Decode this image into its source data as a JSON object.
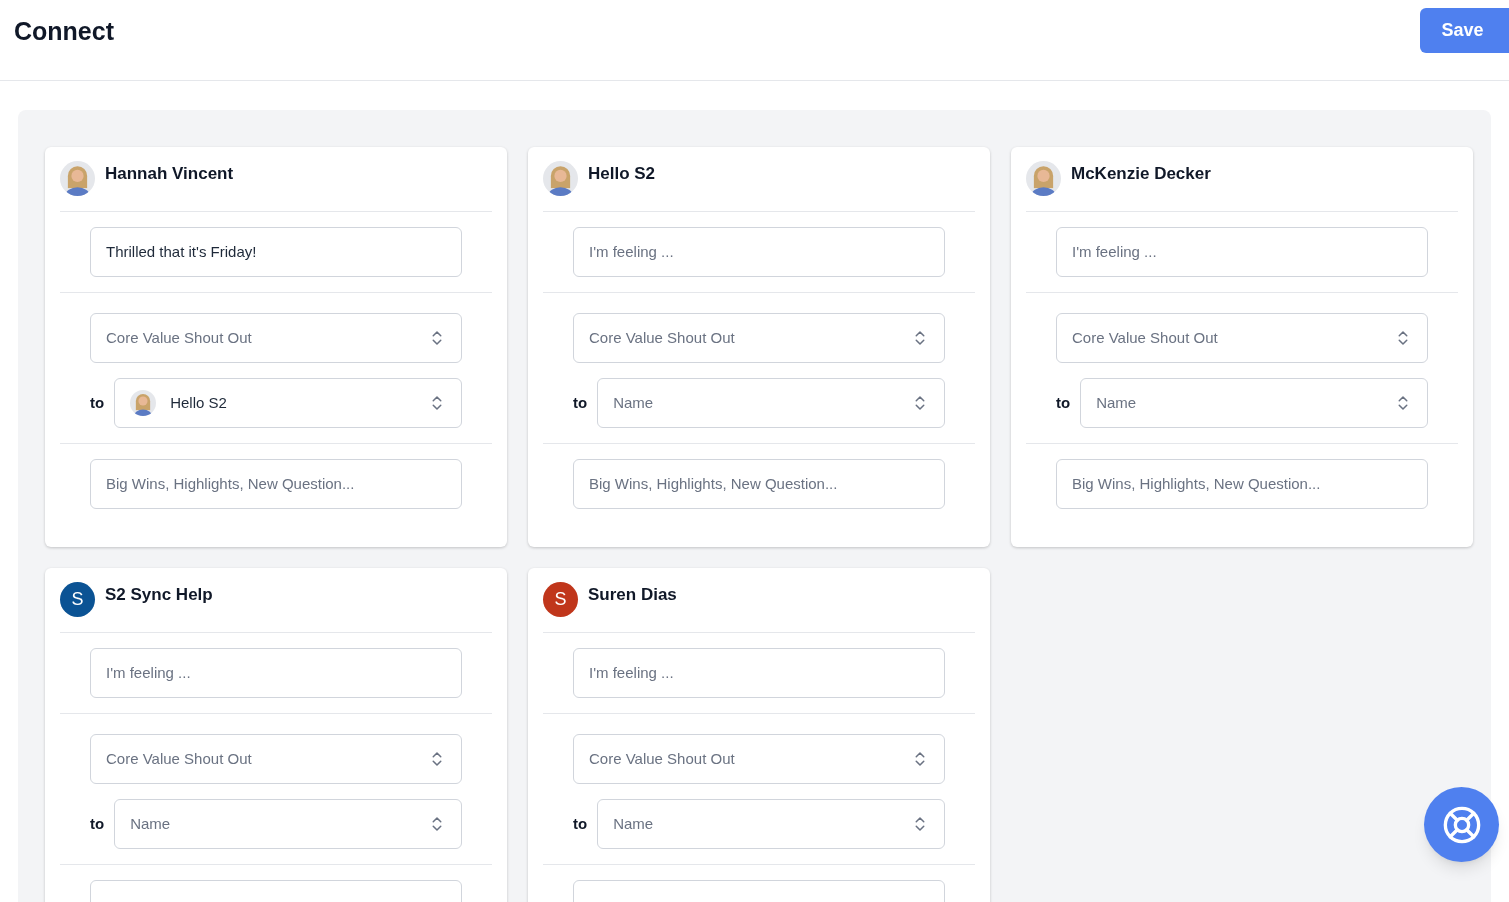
{
  "header": {
    "title": "Connect",
    "save_button": "Save"
  },
  "cards": [
    {
      "name": "Hannah Vincent",
      "feeling": {
        "value": "Thrilled that it's Friday!"
      },
      "shout_out": {
        "placeholder": "Core Value Shout Out"
      },
      "to_label": "to",
      "to": {
        "value": "Hello S2"
      },
      "wins": {
        "placeholder": "Big Wins, Highlights, New Question..."
      }
    },
    {
      "name": "Hello S2",
      "feeling": {
        "placeholder": "I'm feeling ..."
      },
      "shout_out": {
        "placeholder": "Core Value Shout Out"
      },
      "to_label": "to",
      "to": {
        "placeholder": "Name"
      },
      "wins": {
        "placeholder": "Big Wins, Highlights, New Question..."
      }
    },
    {
      "name": "McKenzie Decker",
      "feeling": {
        "placeholder": "I'm feeling ..."
      },
      "shout_out": {
        "placeholder": "Core Value Shout Out"
      },
      "to_label": "to",
      "to": {
        "placeholder": "Name"
      },
      "wins": {
        "placeholder": "Big Wins, Highlights, New Question..."
      }
    },
    {
      "name": "S2 Sync Help",
      "avatar": {
        "kind": "letter",
        "letter": "S",
        "color": "#0b5394"
      },
      "feeling": {
        "placeholder": "I'm feeling ..."
      },
      "shout_out": {
        "placeholder": "Core Value Shout Out"
      },
      "to_label": "to",
      "to": {
        "placeholder": "Name"
      }
    },
    {
      "name": "Suren Dias",
      "avatar": {
        "kind": "letter",
        "letter": "S",
        "color": "#c0361b"
      },
      "feeling": {
        "placeholder": "I'm feeling ..."
      },
      "shout_out": {
        "placeholder": "Core Value Shout Out"
      },
      "to_label": "to",
      "to": {
        "placeholder": "Name"
      }
    }
  ]
}
